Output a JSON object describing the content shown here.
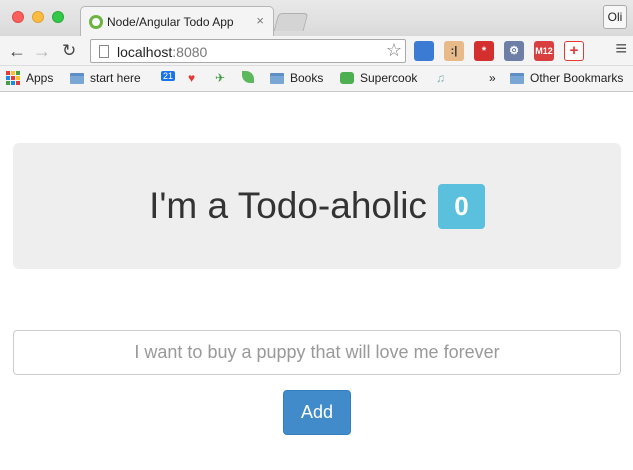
{
  "browser": {
    "tab_title": "Node/Angular Todo App",
    "tab_close": "×",
    "user_label": "Oli",
    "url_host": "localhost",
    "url_port": ":8080"
  },
  "bookmarks": [
    {
      "label": "Apps",
      "icon": "apps-grid-icon"
    },
    {
      "label": "start here",
      "icon": "folder-icon"
    },
    {
      "label": "21",
      "icon": "calendar-icon"
    },
    {
      "label": "",
      "icon": "pocket-icon"
    },
    {
      "label": "",
      "icon": "bird-icon"
    },
    {
      "label": "",
      "icon": "leaf-icon"
    },
    {
      "label": "Books",
      "icon": "folder-icon"
    },
    {
      "label": "Supercook",
      "icon": "supercook-icon"
    },
    {
      "label": "",
      "icon": "music-icon"
    },
    {
      "label": "»",
      "icon": "overflow-chevron"
    },
    {
      "label": "Other Bookmarks",
      "icon": "folder-icon"
    }
  ],
  "page": {
    "heading": "I'm a Todo-aholic",
    "todo_count": "0",
    "input_placeholder": "I want to buy a puppy that will love me forever",
    "add_label": "Add"
  },
  "colors": {
    "badge": "#5bc0de",
    "add_button": "#428bca",
    "jumbotron": "#eeeeee"
  }
}
